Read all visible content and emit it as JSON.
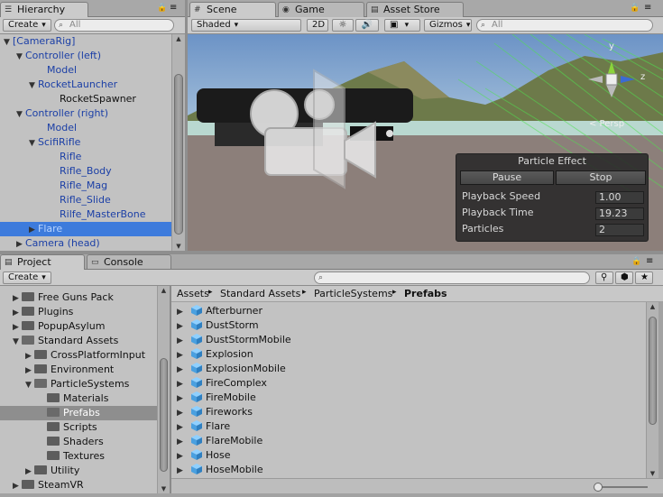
{
  "hierarchy": {
    "tab": "Hierarchy",
    "create_label": "Create",
    "search_placeholder": "All",
    "rows": [
      {
        "label": "[CameraRig]",
        "expanded": "▼",
        "style": "blue"
      },
      {
        "label": "Controller (left)",
        "expanded": "▼",
        "style": "blue"
      },
      {
        "label": "Model",
        "expanded": "",
        "style": "blue"
      },
      {
        "label": "RocketLauncher",
        "expanded": "▼",
        "style": "blue"
      },
      {
        "label": "RocketSpawner",
        "expanded": "",
        "style": "plain"
      },
      {
        "label": "Controller (right)",
        "expanded": "▼",
        "style": "blue"
      },
      {
        "label": "Model",
        "expanded": "",
        "style": "blue"
      },
      {
        "label": "ScifiRifle",
        "expanded": "▼",
        "style": "blue"
      },
      {
        "label": "Rifle",
        "expanded": "",
        "style": "blue"
      },
      {
        "label": "Rifle_Body",
        "expanded": "",
        "style": "blue"
      },
      {
        "label": "Rifle_Mag",
        "expanded": "",
        "style": "blue"
      },
      {
        "label": "Rifle_Slide",
        "expanded": "",
        "style": "blue"
      },
      {
        "label": "Rilfe_MasterBone",
        "expanded": "",
        "style": "blue"
      },
      {
        "label": "Flare",
        "expanded": "▶",
        "style": "selected"
      },
      {
        "label": "Camera (head)",
        "expanded": "▶",
        "style": "blue"
      }
    ]
  },
  "scene": {
    "tabs": [
      "Scene",
      "Game",
      "Asset Store"
    ],
    "shading_mode": "Shaded",
    "mode_2d": "2D",
    "gizmos_label": "Gizmos",
    "search_placeholder": "All",
    "persp_label": "< Persp",
    "gizmo_axes": {
      "y": "y",
      "z": "z"
    }
  },
  "particle_effect": {
    "title": "Particle Effect",
    "pause_label": "Pause",
    "stop_label": "Stop",
    "playback_speed_label": "Playback Speed",
    "playback_speed": "1.00",
    "playback_time_label": "Playback Time",
    "playback_time": "19.23",
    "particles_label": "Particles",
    "particles": "2"
  },
  "project": {
    "tabs": [
      "Project",
      "Console"
    ],
    "create_label": "Create",
    "tree": [
      {
        "label": "Free Guns Pack",
        "expand": "▶",
        "open": false,
        "selected": false
      },
      {
        "label": "Plugins",
        "expand": "▶",
        "open": false,
        "selected": false
      },
      {
        "label": "PopupAsylum",
        "expand": "▶",
        "open": false,
        "selected": false
      },
      {
        "label": "Standard Assets",
        "expand": "▼",
        "open": true,
        "selected": false
      },
      {
        "label": "CrossPlatformInput",
        "expand": "▶",
        "open": false,
        "selected": false
      },
      {
        "label": "Environment",
        "expand": "▶",
        "open": false,
        "selected": false
      },
      {
        "label": "ParticleSystems",
        "expand": "▼",
        "open": true,
        "selected": false
      },
      {
        "label": "Materials",
        "expand": "",
        "open": false,
        "selected": false
      },
      {
        "label": "Prefabs",
        "expand": "",
        "open": true,
        "selected": true
      },
      {
        "label": "Scripts",
        "expand": "",
        "open": false,
        "selected": false
      },
      {
        "label": "Shaders",
        "expand": "",
        "open": false,
        "selected": false
      },
      {
        "label": "Textures",
        "expand": "",
        "open": false,
        "selected": false
      },
      {
        "label": "Utility",
        "expand": "▶",
        "open": false,
        "selected": false
      },
      {
        "label": "SteamVR",
        "expand": "▶",
        "open": false,
        "selected": false
      }
    ],
    "breadcrumbs": [
      "Assets",
      "Standard Assets",
      "ParticleSystems",
      "Prefabs"
    ],
    "assets": [
      "Afterburner",
      "DustStorm",
      "DustStormMobile",
      "Explosion",
      "ExplosionMobile",
      "FireComplex",
      "FireMobile",
      "Fireworks",
      "Flare",
      "FlareMobile",
      "Hose",
      "HoseMobile"
    ]
  },
  "colors": {
    "selection_blue": "#3d7bdc",
    "gameobject_blue": "#1b3fa6",
    "prefab_cube": "#4aa0e0"
  }
}
